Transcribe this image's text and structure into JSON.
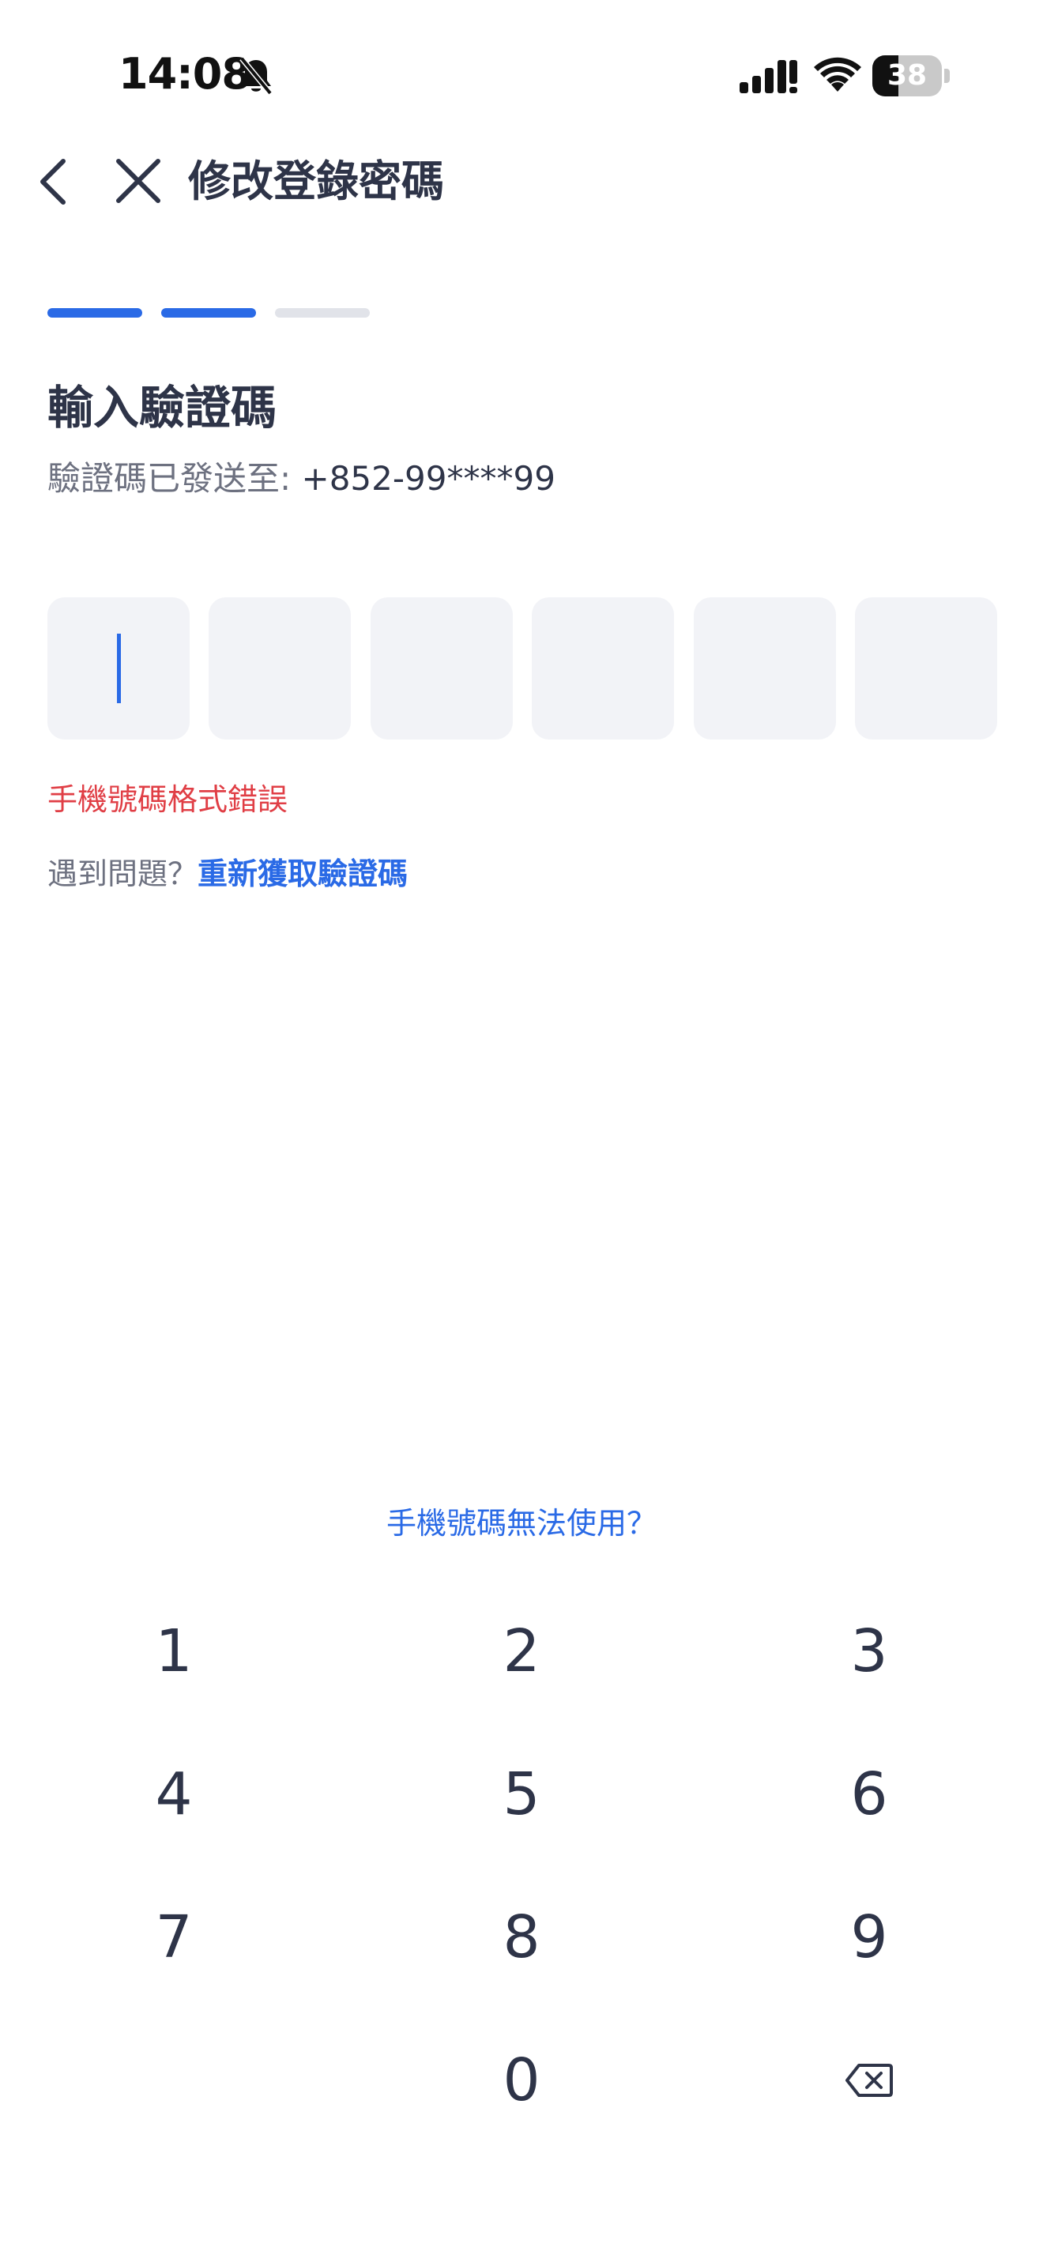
{
  "status_bar": {
    "time": "14:08",
    "battery_level": "38",
    "icons": [
      "bell-slash-icon",
      "signal-icon",
      "wifi-icon",
      "battery-icon"
    ]
  },
  "nav": {
    "back_icon": "chevron-left-icon",
    "close_icon": "close-icon",
    "title": "修改登錄密碼"
  },
  "progress": {
    "total_steps": 3,
    "completed_steps": 2
  },
  "heading": "輸入驗證碼",
  "sent_to_label": "驗證碼已發送至: ",
  "phone_number": "+852-99****99",
  "code_inputs": [
    "",
    "",
    "",
    "",
    "",
    ""
  ],
  "error_message": "手機號碼格式錯誤",
  "problem_prompt": "遇到問題？",
  "resend_link": "重新獲取驗證碼",
  "phone_unavailable_link": "手機號碼無法使用？",
  "keypad": {
    "keys": [
      "1",
      "2",
      "3",
      "4",
      "5",
      "6",
      "7",
      "8",
      "9",
      "",
      "0",
      "delete"
    ],
    "delete_icon": "backspace-icon"
  },
  "colors": {
    "accent": "#2a6ae6",
    "error": "#e03e45",
    "text": "#2e3448",
    "muted": "#6d7180",
    "box_bg": "#f2f3f7"
  }
}
